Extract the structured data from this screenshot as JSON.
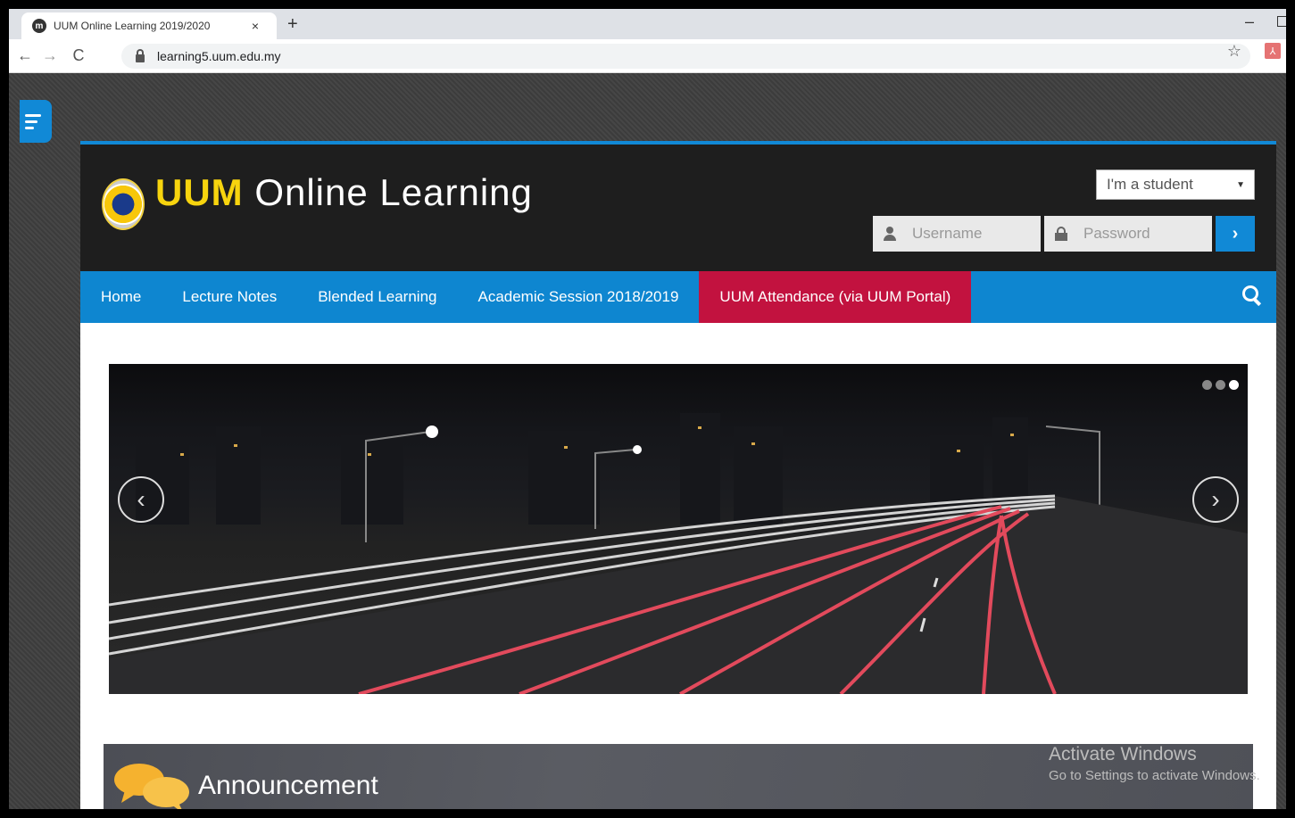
{
  "browser": {
    "tab_title": "UUM Online Learning 2019/2020",
    "tab_close": "×",
    "new_tab": "+",
    "url": "learning5.uum.edu.my",
    "minimize": "–"
  },
  "site": {
    "logo_bold": "UUM",
    "logo_rest": " Online Learning",
    "role_select": "I'm a student",
    "username_placeholder": "Username",
    "password_placeholder": "Password",
    "submit_label": "›"
  },
  "nav": {
    "items": [
      {
        "label": "Home"
      },
      {
        "label": "Lecture Notes"
      },
      {
        "label": "Blended Learning"
      },
      {
        "label": "Academic Session 2018/2019"
      },
      {
        "label": "UUM Attendance (via UUM Portal)"
      }
    ]
  },
  "slider": {
    "prev": "‹",
    "next": "›",
    "slides_total": 3,
    "active_slide": 3
  },
  "announcement": {
    "title": "Announcement"
  },
  "watermark": {
    "line1": "Activate Windows",
    "line2": "Go to Settings to activate Windows."
  },
  "colors": {
    "accent_blue": "#0e86d0",
    "highlight_red": "#c2123f",
    "logo_yellow": "#f7d40e"
  }
}
